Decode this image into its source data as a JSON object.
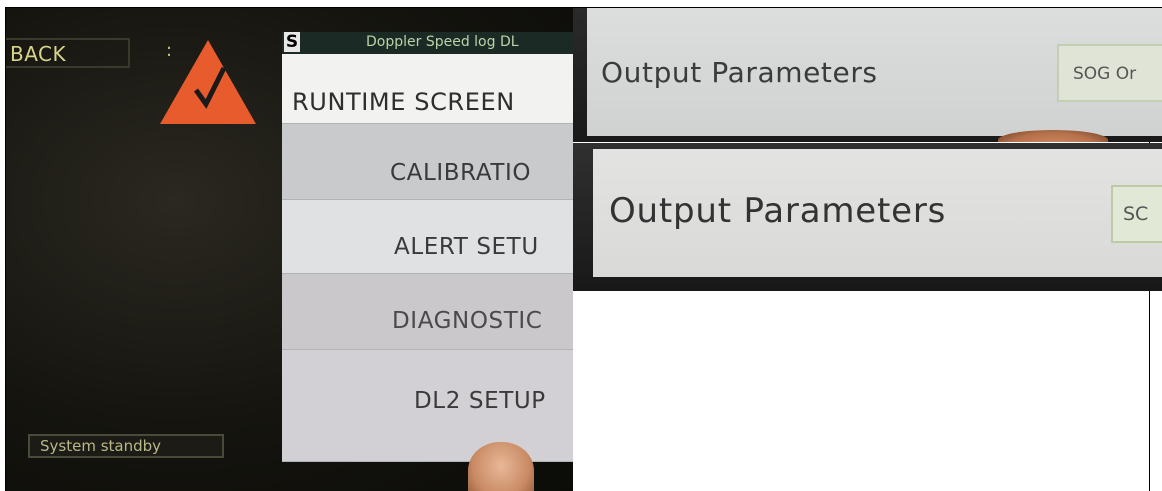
{
  "left_screen": {
    "back_label": "BACK",
    "colon": ":",
    "status": "System standby",
    "menu": {
      "logo": "S",
      "title": "Doppler Speed log DL",
      "items": [
        {
          "label": "RUNTIME SCREEN"
        },
        {
          "label": "CALIBRATIO"
        },
        {
          "label": "ALERT SETU"
        },
        {
          "label": "DIAGNOSTIC"
        },
        {
          "label": "DL2 SETUP"
        }
      ]
    }
  },
  "right_top": {
    "label": "Output Parameters",
    "button": "SOG Or"
  },
  "right_bottom": {
    "label": "Output Parameters",
    "button": "SC"
  },
  "colors": {
    "warning_triangle": "#e85b2c",
    "status_text": "#d8d48a",
    "menu_background": "#d6d8da",
    "title_bar": "#1b2a24"
  },
  "icons": [
    "warning-check-icon",
    "s-logo-icon"
  ]
}
